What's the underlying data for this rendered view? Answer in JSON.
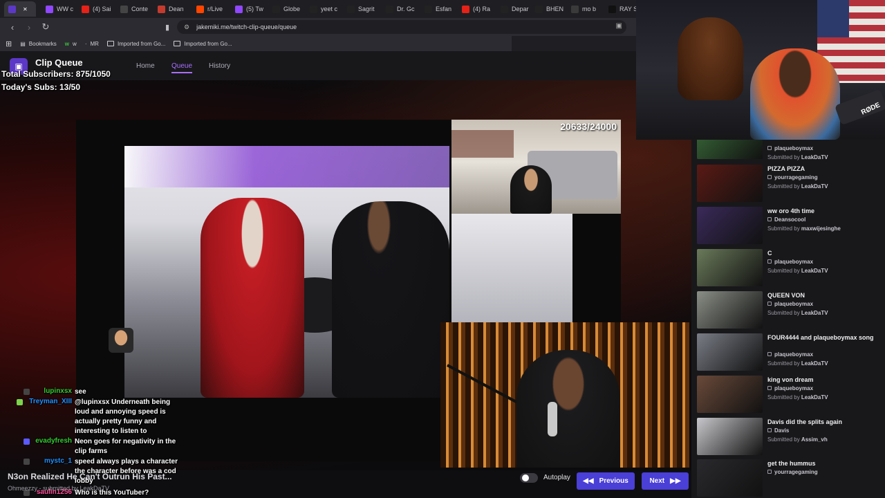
{
  "browser": {
    "tabs": [
      {
        "label": "",
        "color": "#5c38c7",
        "active": true
      },
      {
        "label": "WW c",
        "color": "#9147ff"
      },
      {
        "label": "(4) Sai",
        "color": "#e62117"
      },
      {
        "label": "Conte",
        "color": "#444444"
      },
      {
        "label": "Dean",
        "color": "#c43b2e"
      },
      {
        "label": "r/Live",
        "color": "#ff4500"
      },
      {
        "label": "(5) Tw",
        "color": "#9147ff"
      },
      {
        "label": "Globe",
        "color": "#222222"
      },
      {
        "label": "yeet c",
        "color": "#222222"
      },
      {
        "label": "Sagrit",
        "color": "#222222"
      },
      {
        "label": "Dr. Gc",
        "color": "#222222"
      },
      {
        "label": "Esfan",
        "color": "#222222"
      },
      {
        "label": "(4) Ra",
        "color": "#e62117"
      },
      {
        "label": "Depar",
        "color": "#222222"
      },
      {
        "label": "BHEN",
        "color": "#222222"
      },
      {
        "label": "mo b",
        "color": "#3a3a3a"
      },
      {
        "label": "RAY S",
        "color": "#111111"
      }
    ],
    "url": "jakemiki.me/twitch-clip-queue/queue",
    "bookmarks": [
      {
        "label": "Bookmarks",
        "icon": "bookmarks-icon"
      },
      {
        "label": "w",
        "icon": "w-icon"
      },
      {
        "label": "MR",
        "icon": "mr-icon"
      },
      {
        "label": "Imported from Go...",
        "icon": "folder-icon"
      },
      {
        "label": "Imported from Go...",
        "icon": "folder-icon"
      }
    ]
  },
  "app": {
    "title": "Clip Queue",
    "nav": [
      {
        "label": "Home",
        "active": false
      },
      {
        "label": "Queue",
        "active": true
      },
      {
        "label": "History",
        "active": false
      }
    ],
    "accent": "#a970ff"
  },
  "overlay": {
    "total_subs": "Total Subscribers: 875/1050",
    "today_subs": "Today's Subs: 13/50",
    "goal_counter": "20633/24000"
  },
  "chat": [
    {
      "name": "lupinxsx",
      "name_color": "#32cd32",
      "message": "see"
    },
    {
      "name": "Treyman_XIII",
      "name_color": "#1e90ff",
      "message": "@lupinxsx Underneath being loud and annoying speed is actually pretty funny and interesting to listen to"
    },
    {
      "name": "evadyfresh",
      "name_color": "#32cd32",
      "message": "Neon goes for negativity in the clip farms"
    },
    {
      "name": "mystc_1",
      "name_color": "#1e90ff",
      "message": "speed always plays a character the character before was a cod lobby"
    },
    {
      "name": "saulin1256",
      "name_color": "#ff4f9a",
      "message": "Who is this YouTuber?"
    }
  ],
  "current_clip": {
    "title": "N3on Realized He Can't Outrun His Past...",
    "meta": "Ohmeezzy - submitted by LeakDaTV"
  },
  "controls": {
    "autoplay_label": "Autoplay",
    "previous_label": "Previous",
    "next_label": "Next"
  },
  "queue": [
    {
      "title": "",
      "channel": "plaqueboymax",
      "submitter": "LeakDaTV",
      "thumb": "#3a6b3a"
    },
    {
      "title": "PIZZA PIZZA",
      "channel": "yourragegaming",
      "submitter": "LeakDaTV",
      "thumb": "#5a1a14"
    },
    {
      "title": "ww oro 4th time",
      "channel": "Deansocool",
      "submitter": "maxwijesinghe",
      "thumb": "#3a2a5a"
    },
    {
      "title": "C",
      "channel": "plaqueboymax",
      "submitter": "LeakDaTV",
      "thumb": "#6a7a5a"
    },
    {
      "title": "QUEEN VON",
      "channel": "plaqueboymax",
      "submitter": "LeakDaTV",
      "thumb": "#8a8f86"
    },
    {
      "title": "FOUR4444 and plaqueboymax song",
      "channel": "plaqueboymax",
      "submitter": "LeakDaTV",
      "thumb": "#7a7d86"
    },
    {
      "title": "king von dream",
      "channel": "plaqueboymax",
      "submitter": "LeakDaTV",
      "thumb": "#6a4a3a"
    },
    {
      "title": "Davis did the splits again",
      "channel": "Davis",
      "submitter": "Assim_vh",
      "thumb": "#c8c8cc"
    },
    {
      "title": "get the hummus",
      "channel": "yourragegaming",
      "submitter": "",
      "thumb": "#2a2a2e"
    }
  ],
  "webcam": {
    "mic_brand": "RØDE"
  }
}
